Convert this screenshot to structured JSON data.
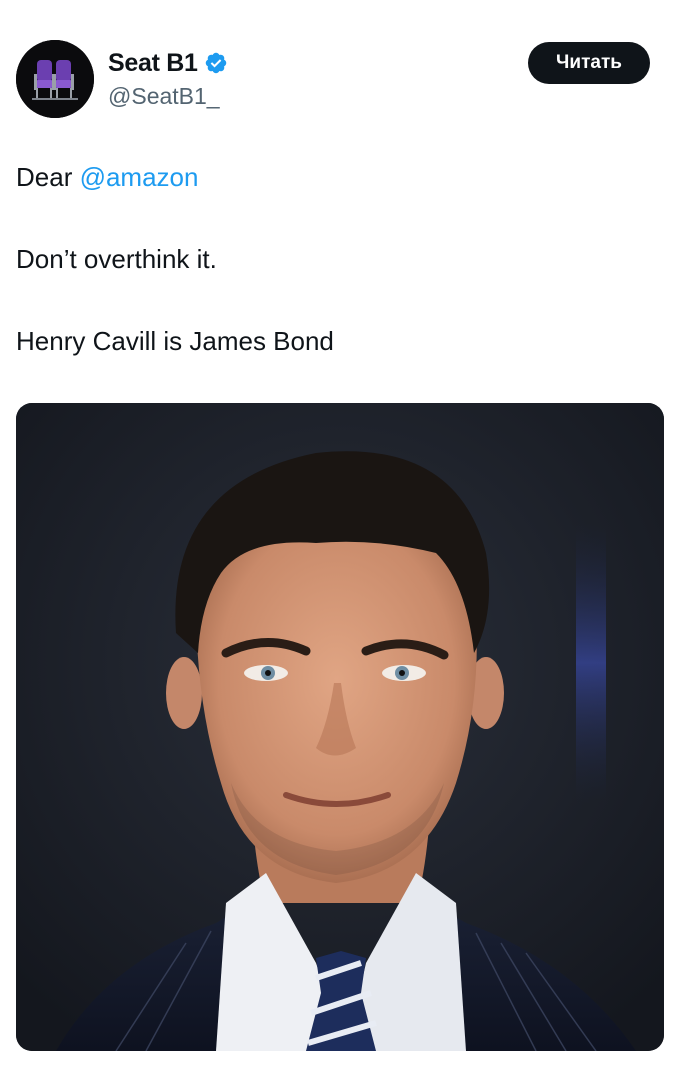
{
  "author": {
    "display_name": "Seat B1",
    "handle": "@SeatB1_",
    "verified": true,
    "avatar_icon": "cinema-seats-icon"
  },
  "follow_button": {
    "label": "Читать"
  },
  "tweet": {
    "line1_prefix": "Dear ",
    "line1_mention": "@amazon",
    "line2": "Don’t overthink it.",
    "line3": "Henry Cavill is James Bond"
  },
  "media": {
    "type": "photo",
    "subject": "portrait-photo"
  },
  "colors": {
    "accent": "#1d9bf0",
    "text": "#0f1419",
    "secondary_text": "#536471",
    "button_bg": "#0f1419"
  }
}
